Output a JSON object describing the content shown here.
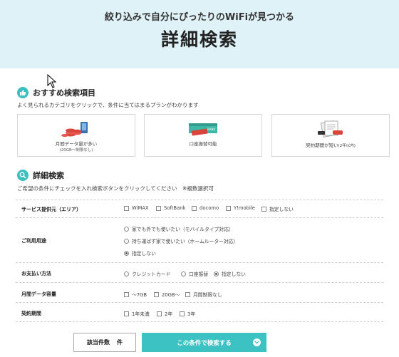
{
  "hero": {
    "tagline": "絞り込みで自分にぴったりのWiFiが見つかる",
    "title": "詳細検索"
  },
  "recommended": {
    "title": "おすすめ検索項目",
    "description": "よく見られるカテゴリをクリックで、条件に当てはまるプランがわかります",
    "cards": [
      {
        "label": "月間データ量が多い",
        "sub": "(20GB～制限なし)"
      },
      {
        "label": "口座振替可能",
        "sub": ""
      },
      {
        "label": "契約期間が短い",
        "sub": "(2年以内)"
      }
    ]
  },
  "detail": {
    "title": "詳細検索",
    "description": "ご希望の条件にチェックを入れ検索ボタンをクリックしてください　※複数選択可"
  },
  "filters": {
    "provider": {
      "label": "サービス提供元（エリア）",
      "options": [
        "WiMAX",
        "SoftBank",
        "docomo",
        "Y!mobile",
        "指定しない"
      ]
    },
    "usage": {
      "label": "ご利用用途",
      "options": [
        "家でも外でも使いたい（モバイルタイプ対応）",
        "持ち運ばず家で使いたい（ホームルーター対応）",
        "指定しない"
      ],
      "selected": "指定しない"
    },
    "payment": {
      "label": "お支払い方法",
      "options": [
        "クレジットカード",
        "口座振替",
        "指定しない"
      ],
      "selected": "指定しない"
    },
    "data": {
      "label": "月間データ容量",
      "options": [
        "～7GB",
        "20GB～",
        "月間制限なし"
      ]
    },
    "contract": {
      "label": "契約期間",
      "options": [
        "1年未満",
        "2年",
        "3年"
      ]
    }
  },
  "footer": {
    "count_label": "該当件数",
    "count_suffix": "件",
    "search_label": "この条件で検索する"
  },
  "colors": {
    "accent": "#3cc2c2",
    "hero_bg": "#dff2f7"
  }
}
